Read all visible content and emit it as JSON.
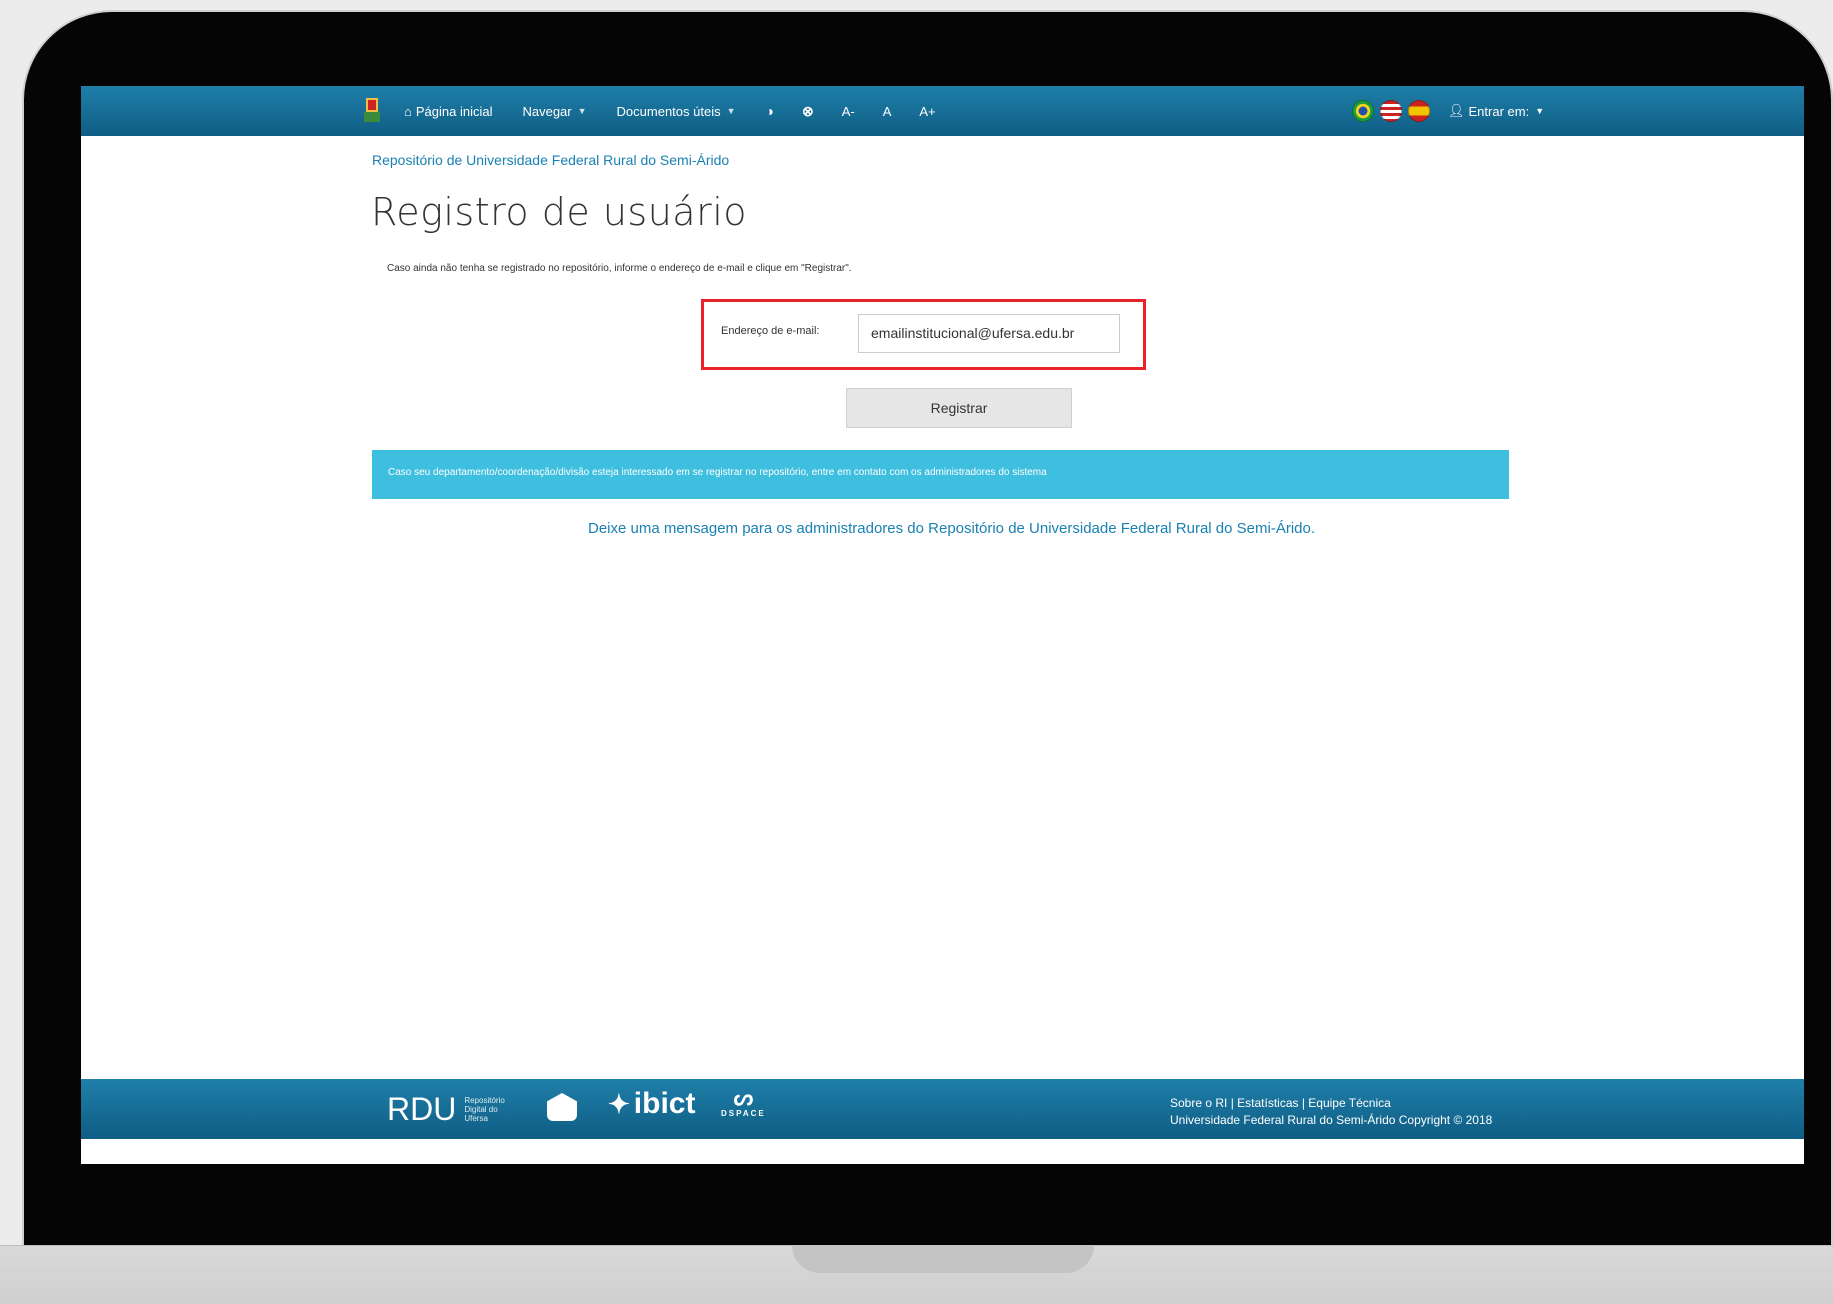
{
  "nav": {
    "home_label": "Página inicial",
    "browse_label": "Navegar",
    "docs_label": "Documentos úteis",
    "contrast_icon": "◑",
    "reset_icon": "⊗",
    "font_minus": "A-",
    "font_normal": "A",
    "font_plus": "A+",
    "login_label": "Entrar em:"
  },
  "breadcrumb": "Repositório de Universidade Federal Rural do Semi-Árido",
  "page_title": "Registro de usuário",
  "intro": "Caso ainda não tenha se registrado no repositório, informe o endereço de e-mail e clique em \"Registrar\".",
  "form": {
    "email_label": "Endereço de e-mail:",
    "email_value": "emailinstitucional@ufersa.edu.br",
    "submit_label": "Registrar"
  },
  "info_bar": "Caso seu departamento/coordenação/divisão esteja interessado em se registrar no repositório, entre em contato com os administradores do sistema",
  "contact_link": "Deixe uma mensagem para os administradores do Repositório de Universidade Federal Rural do Semi-Árido.",
  "footer": {
    "rdu": "RDU",
    "rdu_sub": "Repositório Digital do Ufersa",
    "ibict": "ibict",
    "dspace": "DSPACE",
    "links_line": "Sobre o RI | Estatísticas | Equipe Técnica",
    "copyright": "Universidade Federal Rural do Semi-Árido Copyright © 2018"
  },
  "colors": {
    "nav_bg": "#1670a0",
    "link": "#1a81b3",
    "info_bar": "#3fbfdf",
    "highlight_border": "#e8232a"
  }
}
